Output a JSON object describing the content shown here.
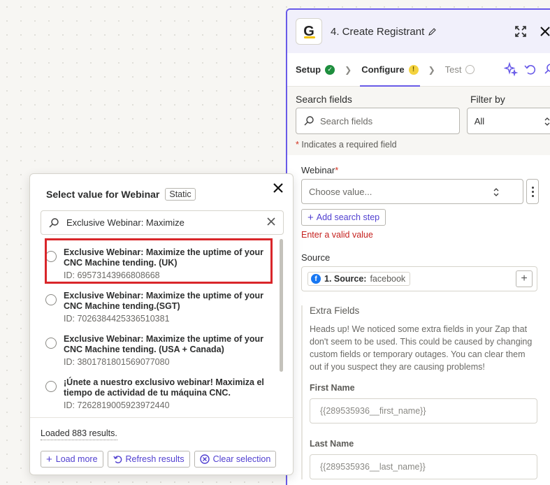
{
  "panel": {
    "title": "4. Create Registrant",
    "app_initial": "G",
    "tabs": [
      {
        "label": "Setup",
        "status": "complete"
      },
      {
        "label": "Configure",
        "status": "warning",
        "warn_symbol": "!"
      },
      {
        "label": "Test",
        "status": "pending"
      }
    ],
    "search_fields_label": "Search fields",
    "search_placeholder": "Search fields",
    "filter_label": "Filter by",
    "filter_value": "All",
    "required_note": "Indicates a required field",
    "webinar_label": "Webinar",
    "choose_placeholder": "Choose value...",
    "add_search_step": "Add search step",
    "error_text": "Enter a valid value",
    "source_label": "Source",
    "source_pill_step": "1. Source:",
    "source_pill_value": "facebook",
    "source_icon_letter": "f",
    "extra_title": "Extra Fields",
    "extra_text": "Heads up! We noticed some extra fields in your Zap that don't seem to be used. This could be caused by changing custom fields or temporary outages. You can clear them out if you suspect they are causing problems!",
    "first_name_label": "First Name",
    "first_name_value": "{{289535936__first_name}}",
    "last_name_label": "Last Name",
    "last_name_value": "{{289535936__last_name}}"
  },
  "popup": {
    "title": "Select value for Webinar",
    "static_badge": "Static",
    "search_value": "Exclusive Webinar: Maximize",
    "results": [
      {
        "line1": "Exclusive Webinar: Maximize the uptime of your",
        "line2": "CNC Machine tending. (UK)",
        "id": "ID: 69573143966808668"
      },
      {
        "line1": "Exclusive Webinar: Maximize the uptime of your",
        "line2": "CNC Machine tending.(SGT)",
        "id": "ID: 7026384425336510381"
      },
      {
        "line1": "Exclusive Webinar: Maximize the uptime of your",
        "line2": "CNC Machine tending. (USA + Canada)",
        "id": "ID: 3801781801569077080"
      },
      {
        "line1": "¡Únete a nuestro exclusivo webinar! Maximiza el",
        "line2": "tiempo de actividad de tu máquina CNC.",
        "id": "ID: 7262819005923972440"
      }
    ],
    "loaded_text": "Loaded 883 results.",
    "load_more": "Load more",
    "refresh": "Refresh results",
    "clear_selection": "Clear selection"
  },
  "colors": {
    "accent": "#695be8",
    "error": "#c5221f",
    "highlight": "#d9262a"
  }
}
